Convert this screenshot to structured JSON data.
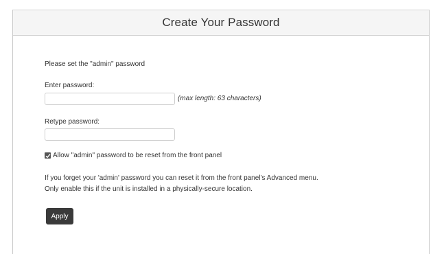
{
  "header": {
    "title": "Create Your Password"
  },
  "form": {
    "intro": "Please set the \"admin\" password",
    "password_label": "Enter password:",
    "password_value": "",
    "password_hint": "(max length: 63 characters)",
    "retype_label": "Retype password:",
    "retype_value": "",
    "allow_reset_checked": true,
    "allow_reset_label": "Allow \"admin\" password to be reset from the front panel",
    "info_line_1": "If you forget your 'admin' password you can reset it from the front panel's Advanced menu.",
    "info_line_2": "Only enable this if the unit is installed in a physically-secure location.",
    "apply_label": "Apply"
  },
  "colors": {
    "button_bg": "#3a3a3a",
    "header_bg": "#f5f5f5"
  }
}
